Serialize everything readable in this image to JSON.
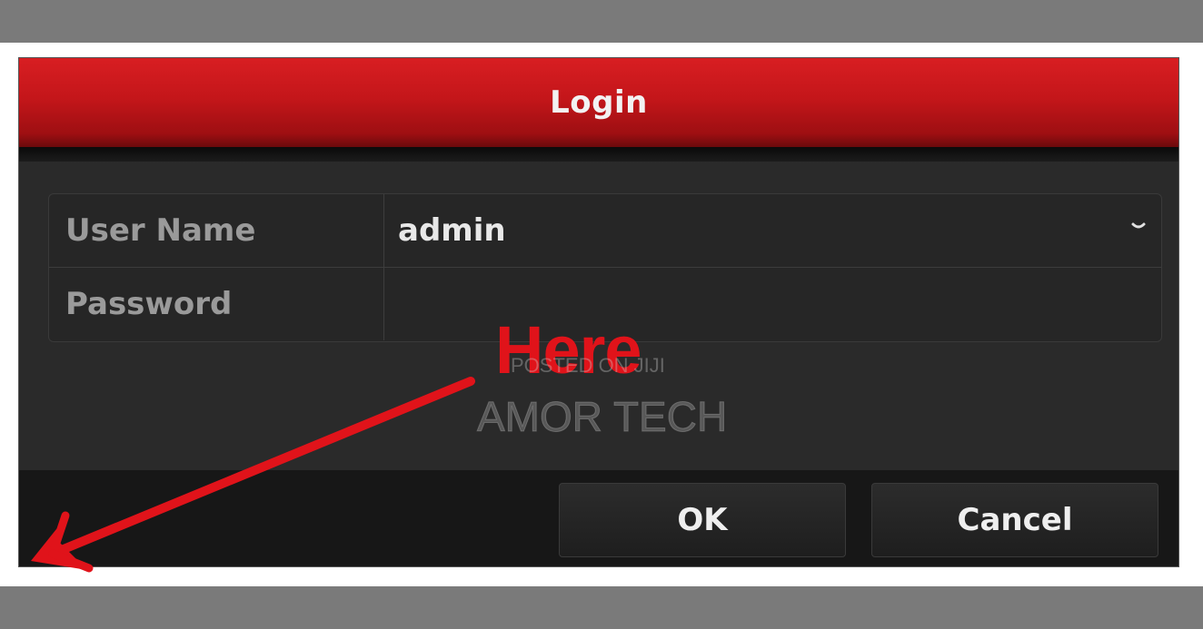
{
  "dialog": {
    "title": "Login",
    "fields": [
      {
        "label": "User Name",
        "value": "admin",
        "type": "select"
      },
      {
        "label": "Password",
        "value": "",
        "type": "password"
      }
    ],
    "buttons": {
      "ok": "OK",
      "cancel": "Cancel"
    }
  },
  "annotation": {
    "text": "Here"
  },
  "watermark": {
    "line1": "POSTED ON JIJI",
    "line2": "AMOR TECH"
  },
  "icons": {
    "username_dropdown": "chevron-down-icon",
    "annotation_arrow": "arrow-icon"
  },
  "colors": {
    "title_red": "#c4161a",
    "annotation_red": "#e0131a",
    "dialog_bg": "#2a2a2a"
  }
}
